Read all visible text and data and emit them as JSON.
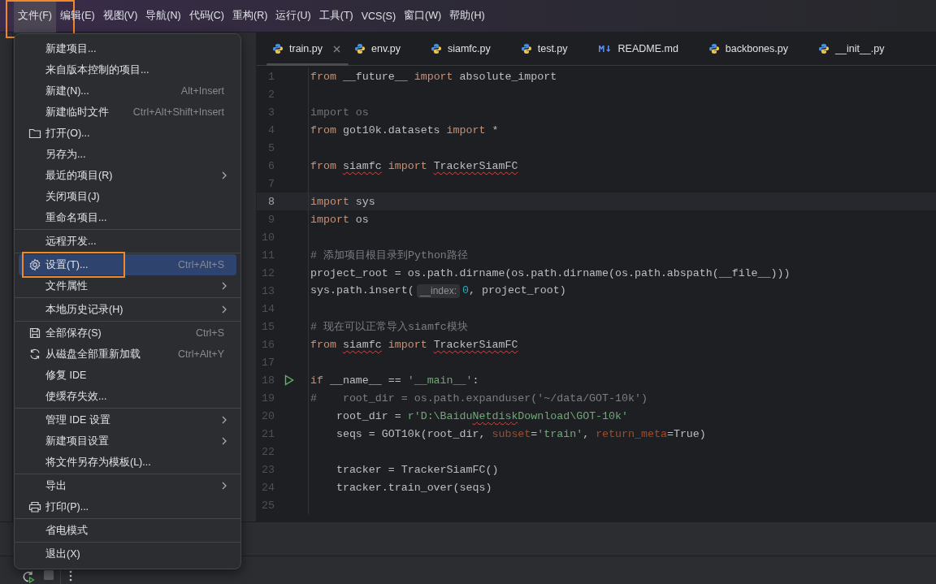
{
  "menu_bar": [
    {
      "label": "文件(F)",
      "selected": true,
      "outlined": true
    },
    {
      "label": "编辑(E)",
      "selected": false
    },
    {
      "label": "视图(V)",
      "selected": false
    },
    {
      "label": "导航(N)",
      "selected": false
    },
    {
      "label": "代码(C)",
      "selected": false
    },
    {
      "label": "重构(R)",
      "selected": false
    },
    {
      "label": "运行(U)",
      "selected": false
    },
    {
      "label": "工具(T)",
      "selected": false
    },
    {
      "label": "VCS(S)",
      "selected": false
    },
    {
      "label": "窗口(W)",
      "selected": false
    },
    {
      "label": "帮助(H)",
      "selected": false
    }
  ],
  "file_menu": {
    "groups": [
      {
        "items": [
          {
            "label": "新建项目...",
            "kind": "plain",
            "selected": false,
            "submenu": false
          },
          {
            "label": "来自版本控制的项目...",
            "kind": "plain",
            "selected": false,
            "submenu": false
          },
          {
            "label": "新建(N)...",
            "kind": "plain",
            "shortcut": "Alt+Insert",
            "selected": false,
            "submenu": false
          },
          {
            "label": "新建临时文件",
            "kind": "plain",
            "shortcut": "Ctrl+Alt+Shift+Insert",
            "selected": false,
            "submenu": false
          },
          {
            "label": "打开(O)...",
            "kind": "folder",
            "selected": false,
            "submenu": false
          },
          {
            "label": "另存为...",
            "kind": "plain",
            "selected": false,
            "submenu": false
          },
          {
            "label": "最近的项目(R)",
            "kind": "plain",
            "selected": false,
            "submenu": true
          },
          {
            "label": "关闭项目(J)",
            "kind": "plain",
            "selected": false,
            "submenu": false
          },
          {
            "label": "重命名项目...",
            "kind": "plain",
            "selected": false,
            "submenu": false
          }
        ]
      },
      {
        "items": [
          {
            "label": "远程开发...",
            "kind": "plain",
            "selected": false,
            "submenu": false
          }
        ]
      },
      {
        "items": [
          {
            "label": "设置(T)...",
            "kind": "gear",
            "shortcut": "Ctrl+Alt+S",
            "selected": true,
            "submenu": false,
            "outlined": true
          },
          {
            "label": "文件属性",
            "kind": "plain",
            "selected": false,
            "submenu": true
          }
        ]
      },
      {
        "items": [
          {
            "label": "本地历史记录(H)",
            "kind": "plain",
            "selected": false,
            "submenu": true
          }
        ]
      },
      {
        "items": [
          {
            "label": "全部保存(S)",
            "kind": "save",
            "shortcut": "Ctrl+S",
            "selected": false,
            "submenu": false
          },
          {
            "label": "从磁盘全部重新加载",
            "kind": "reload",
            "shortcut": "Ctrl+Alt+Y",
            "selected": false,
            "submenu": false
          },
          {
            "label": "修复 IDE",
            "kind": "plain",
            "selected": false,
            "submenu": false
          },
          {
            "label": "使缓存失效...",
            "kind": "plain",
            "selected": false,
            "submenu": false
          }
        ]
      },
      {
        "items": [
          {
            "label": "管理 IDE 设置",
            "kind": "plain",
            "selected": false,
            "submenu": true
          },
          {
            "label": "新建项目设置",
            "kind": "plain",
            "selected": false,
            "submenu": true
          },
          {
            "label": "将文件另存为模板(L)...",
            "kind": "plain",
            "selected": false,
            "submenu": false
          }
        ]
      },
      {
        "items": [
          {
            "label": "导出",
            "kind": "plain",
            "selected": false,
            "submenu": true
          },
          {
            "label": "打印(P)...",
            "kind": "print",
            "selected": false,
            "submenu": false
          }
        ]
      },
      {
        "items": [
          {
            "label": "省电模式",
            "kind": "plain",
            "selected": false,
            "submenu": false
          }
        ]
      },
      {
        "items": [
          {
            "label": "退出(X)",
            "kind": "plain",
            "selected": false,
            "submenu": false
          }
        ]
      }
    ]
  },
  "editor": {
    "tabs": [
      {
        "label": "train.py",
        "kind": "python",
        "selected": true,
        "closable": true
      },
      {
        "label": "env.py",
        "kind": "python",
        "selected": false,
        "closable": false
      },
      {
        "label": "siamfc.py",
        "kind": "python",
        "selected": false,
        "closable": false
      },
      {
        "label": "test.py",
        "kind": "python",
        "selected": false,
        "closable": false
      },
      {
        "label": "README.md",
        "kind": "markdown",
        "selected": false,
        "closable": false
      },
      {
        "label": "backbones.py",
        "kind": "python",
        "selected": false,
        "closable": false
      },
      {
        "label": "__init__.py",
        "kind": "python",
        "selected": false,
        "closable": false
      }
    ],
    "lines": [
      {
        "number": "1",
        "current": false,
        "runnable": false,
        "tokens": [
          {
            "text": "from",
            "kind": "kw"
          },
          {
            "text": " __future__ ",
            "kind": "plain"
          },
          {
            "text": "import",
            "kind": "kw"
          },
          {
            "text": " absolute_import",
            "kind": "plain"
          }
        ]
      },
      {
        "number": "2",
        "current": false,
        "runnable": false
      },
      {
        "number": "3",
        "current": false,
        "runnable": false,
        "tokens": [
          {
            "text": "import os",
            "kind": "unused"
          }
        ]
      },
      {
        "number": "4",
        "current": false,
        "runnable": false,
        "tokens": [
          {
            "text": "from",
            "kind": "kw"
          },
          {
            "text": " got10k.datasets ",
            "kind": "plain"
          },
          {
            "text": "import",
            "kind": "kw"
          },
          {
            "text": " *",
            "kind": "plain"
          }
        ]
      },
      {
        "number": "5",
        "current": false,
        "runnable": false
      },
      {
        "number": "6",
        "current": false,
        "runnable": false,
        "tokens": [
          {
            "text": "from ",
            "kind": "kw"
          },
          {
            "text": "siamfc",
            "kind": "plain",
            "error": true
          },
          {
            "text": " import ",
            "kind": "kw"
          },
          {
            "text": "TrackerSiamFC",
            "kind": "plain",
            "error": true
          }
        ]
      },
      {
        "number": "7",
        "current": false,
        "runnable": false
      },
      {
        "number": "8",
        "current": true,
        "runnable": false,
        "tokens": [
          {
            "text": "import",
            "kind": "kw"
          },
          {
            "text": " sys",
            "kind": "plain"
          }
        ]
      },
      {
        "number": "9",
        "current": false,
        "runnable": false,
        "tokens": [
          {
            "text": "import",
            "kind": "kw"
          },
          {
            "text": " os",
            "kind": "plain"
          }
        ]
      },
      {
        "number": "10",
        "current": false,
        "runnable": false
      },
      {
        "number": "11",
        "current": false,
        "runnable": false,
        "tokens": [
          {
            "text": "# 添加项目根目录到Python路径",
            "kind": "comment"
          }
        ]
      },
      {
        "number": "12",
        "current": false,
        "runnable": false,
        "tokens": [
          {
            "text": "project_root = os.path.dirname(os.path.dirname(os.path.abspath(__file__)))",
            "kind": "plain"
          }
        ]
      },
      {
        "number": "13",
        "current": false,
        "runnable": false,
        "tokens": [
          {
            "text": "sys.path.insert(",
            "kind": "plain"
          },
          {
            "text": "__index:",
            "kind": "hint"
          },
          {
            "text": "0",
            "kind": "num"
          },
          {
            "text": ", project_root)",
            "kind": "plain"
          }
        ]
      },
      {
        "number": "14",
        "current": false,
        "runnable": false
      },
      {
        "number": "15",
        "current": false,
        "runnable": false,
        "tokens": [
          {
            "text": "# 现在可以正常导入siamfc模块",
            "kind": "comment"
          }
        ]
      },
      {
        "number": "16",
        "current": false,
        "runnable": false,
        "tokens": [
          {
            "text": "from ",
            "kind": "kw"
          },
          {
            "text": "siamfc",
            "kind": "plain",
            "error": true
          },
          {
            "text": " import ",
            "kind": "kw"
          },
          {
            "text": "TrackerSiamFC",
            "kind": "plain",
            "error": true
          }
        ]
      },
      {
        "number": "17",
        "current": false,
        "runnable": false
      },
      {
        "number": "18",
        "current": false,
        "runnable": true,
        "tokens": [
          {
            "text": "if",
            "kind": "kw"
          },
          {
            "text": " __name__ == ",
            "kind": "plain"
          },
          {
            "text": "'__main__'",
            "kind": "str"
          },
          {
            "text": ":",
            "kind": "plain"
          }
        ]
      },
      {
        "number": "19",
        "current": false,
        "runnable": false,
        "tokens": [
          {
            "text": "#    root_dir = os.path.expanduser('~/data/GOT-10k')",
            "kind": "comment"
          }
        ]
      },
      {
        "number": "20",
        "current": false,
        "runnable": false,
        "tokens": [
          {
            "text": "    root_dir = ",
            "kind": "plain"
          },
          {
            "text": "r'D:\\Baidu",
            "kind": "str"
          },
          {
            "text": "Netdisk",
            "kind": "str",
            "error": true
          },
          {
            "text": "Download\\GOT-10k'",
            "kind": "str"
          }
        ]
      },
      {
        "number": "21",
        "current": false,
        "runnable": false,
        "tokens": [
          {
            "text": "    seqs = GOT10k(root_dir, ",
            "kind": "plain"
          },
          {
            "text": "subset",
            "kind": "named"
          },
          {
            "text": "=",
            "kind": "plain"
          },
          {
            "text": "'train'",
            "kind": "str"
          },
          {
            "text": ", ",
            "kind": "plain"
          },
          {
            "text": "return_meta",
            "kind": "named"
          },
          {
            "text": "=True)",
            "kind": "plain"
          }
        ]
      },
      {
        "number": "22",
        "current": false,
        "runnable": false
      },
      {
        "number": "23",
        "current": false,
        "runnable": false,
        "tokens": [
          {
            "text": "    tracker = TrackerSiamFC()",
            "kind": "plain"
          }
        ]
      },
      {
        "number": "24",
        "current": false,
        "runnable": false,
        "tokens": [
          {
            "text": "    tracker.train_over(seqs)",
            "kind": "plain"
          }
        ]
      },
      {
        "number": "25",
        "current": false,
        "runnable": false
      }
    ]
  }
}
